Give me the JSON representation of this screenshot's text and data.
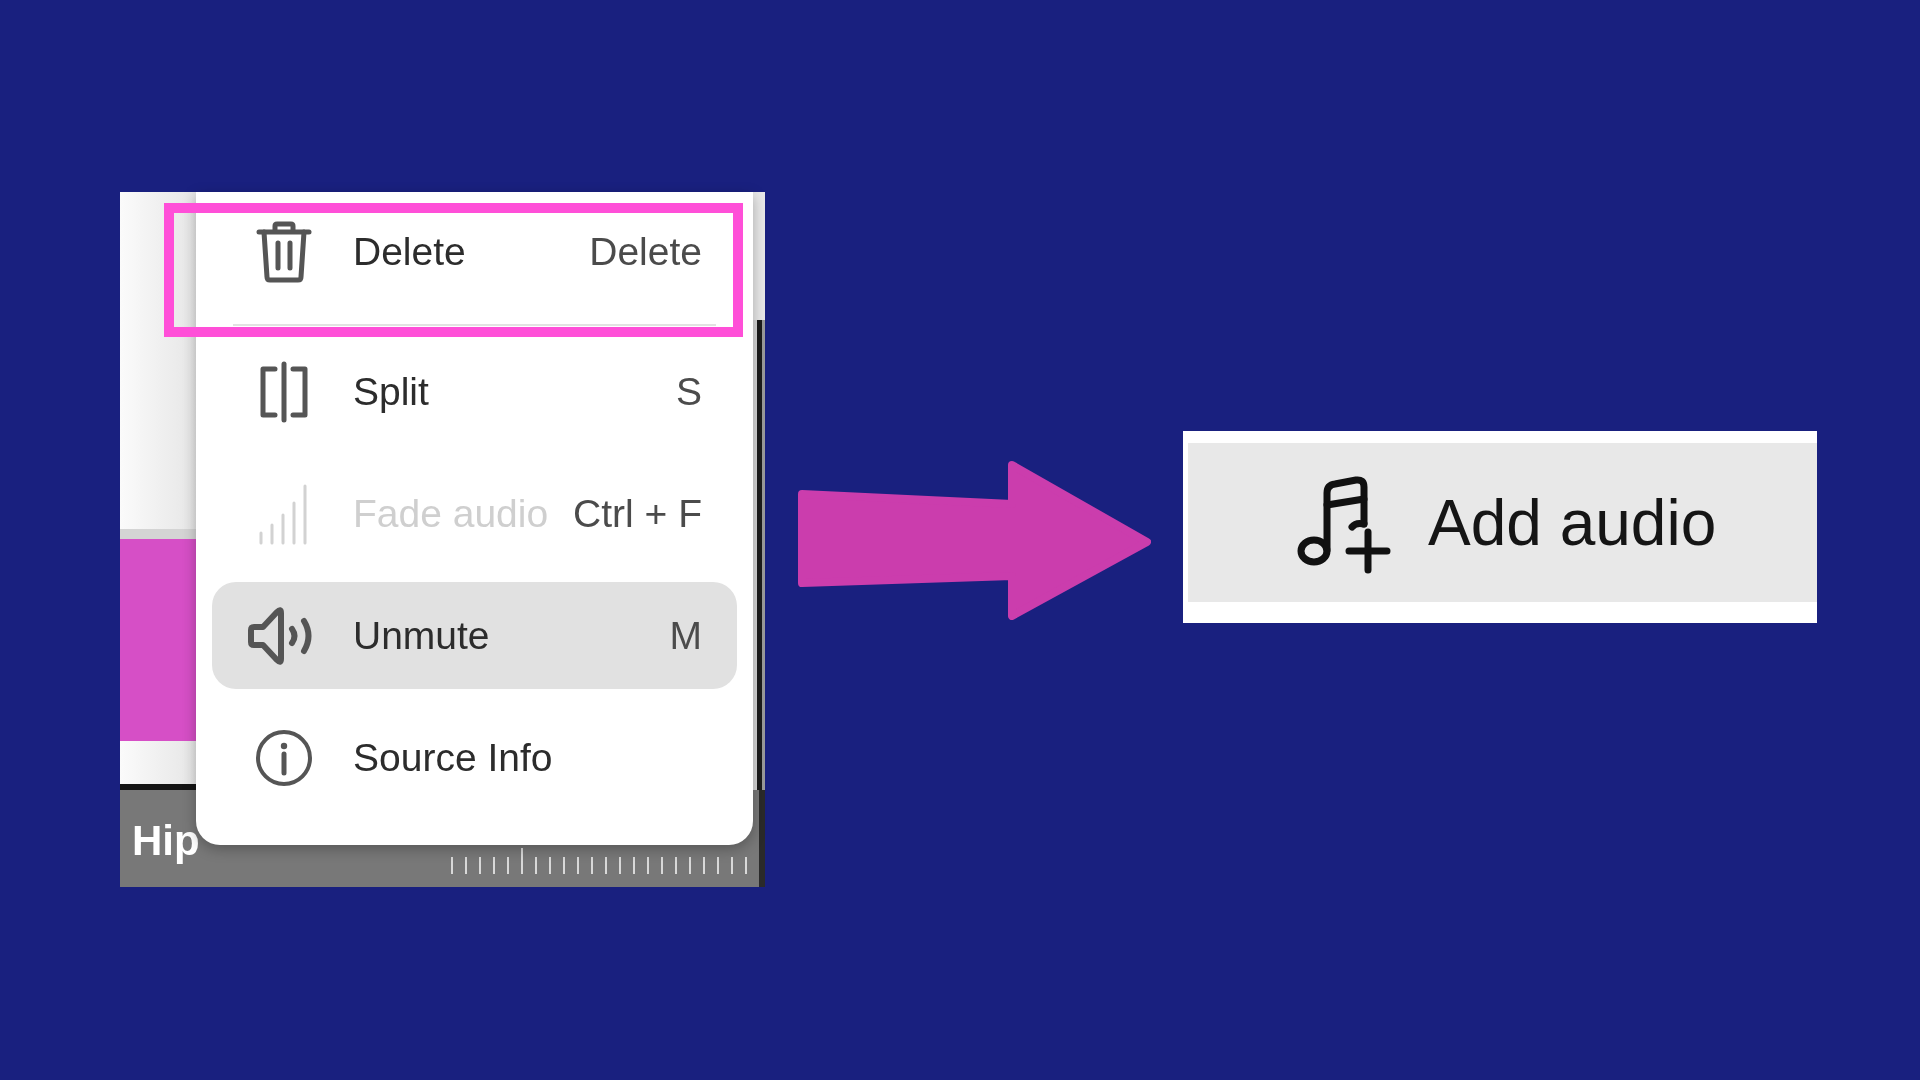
{
  "editor": {
    "context_menu": {
      "items": [
        {
          "kind": "action",
          "label": "Delete",
          "shortcut": "Delete",
          "disabled": false,
          "selected": false,
          "highlighted": true
        },
        {
          "kind": "separator"
        },
        {
          "kind": "action",
          "label": "Split",
          "shortcut": "S",
          "disabled": false,
          "selected": false,
          "highlighted": false
        },
        {
          "kind": "action",
          "label": "Fade audio",
          "shortcut": "Ctrl + F",
          "disabled": true,
          "selected": false,
          "highlighted": false
        },
        {
          "kind": "action",
          "label": "Unmute",
          "shortcut": "M",
          "disabled": false,
          "selected": true,
          "highlighted": false
        },
        {
          "kind": "action",
          "label": "Source Info",
          "disabled": false,
          "selected": false,
          "highlighted": false
        }
      ]
    },
    "track": {
      "label": "Hip"
    }
  },
  "add_audio_button": {
    "label": "Add audio"
  }
}
